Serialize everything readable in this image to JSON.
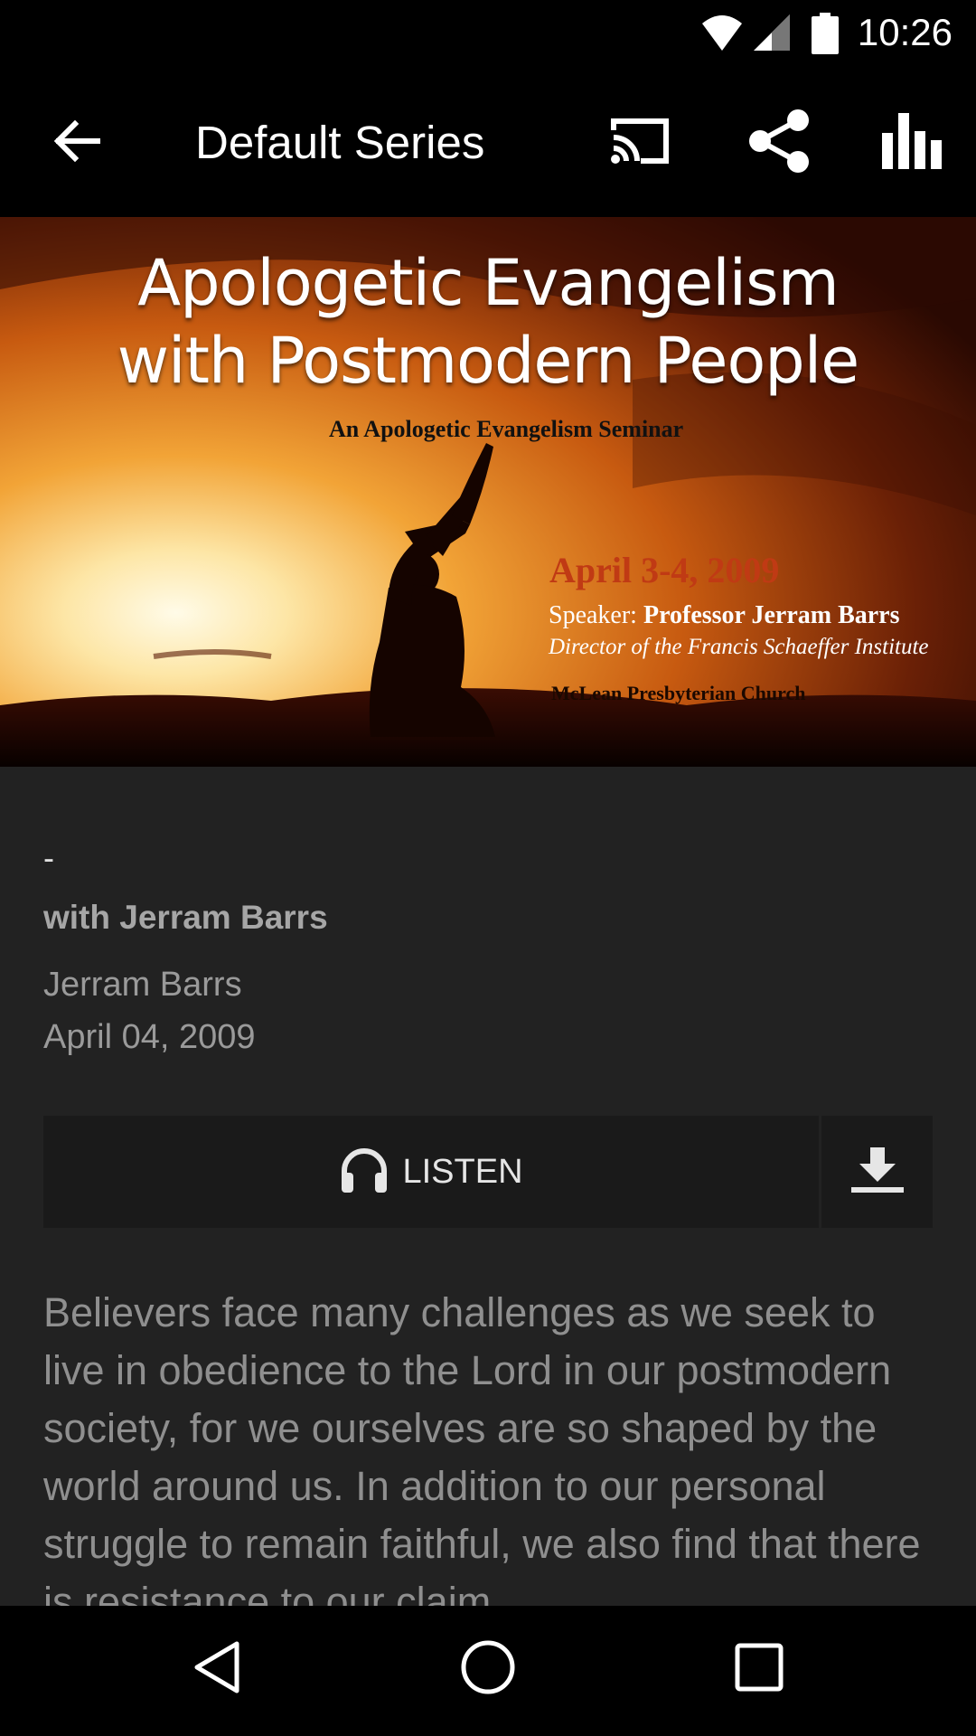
{
  "status_bar": {
    "time": "10:26"
  },
  "toolbar": {
    "title": "Default Series",
    "icons": {
      "back": "arrow-back-icon",
      "cast": "cast-icon",
      "share": "share-icon",
      "stats": "bar-chart-icon"
    }
  },
  "hero": {
    "title_line1": "Apologetic Evangelism",
    "title_line2": "with Postmodern People",
    "subtitle": "An Apologetic Evangelism Seminar",
    "date": "April 3-4, 2009",
    "speaker_prefix": "Speaker: ",
    "speaker_name": "Professor Jerram Barrs",
    "director": "Director of the Francis Schaeffer Institute",
    "church": "McLean Presbyterian Church"
  },
  "sermon": {
    "dash": "-",
    "subtitle": "with Jerram Barrs",
    "speaker": "Jerram Barrs",
    "date": "April 04, 2009",
    "listen_label": "LISTEN",
    "description": "Believers face many challenges as we seek to live in obedience to the Lord in our postmodern society, for we ourselves are so shaped by the world around us. In addition to our personal struggle to remain faithful, we also find that there is resistance to our claim"
  },
  "nav": {
    "back": "nav-back-icon",
    "home": "nav-home-icon",
    "recents": "nav-recents-icon"
  },
  "colors": {
    "background": "#222222",
    "bars": "#000000",
    "button": "#1a1a1a"
  }
}
